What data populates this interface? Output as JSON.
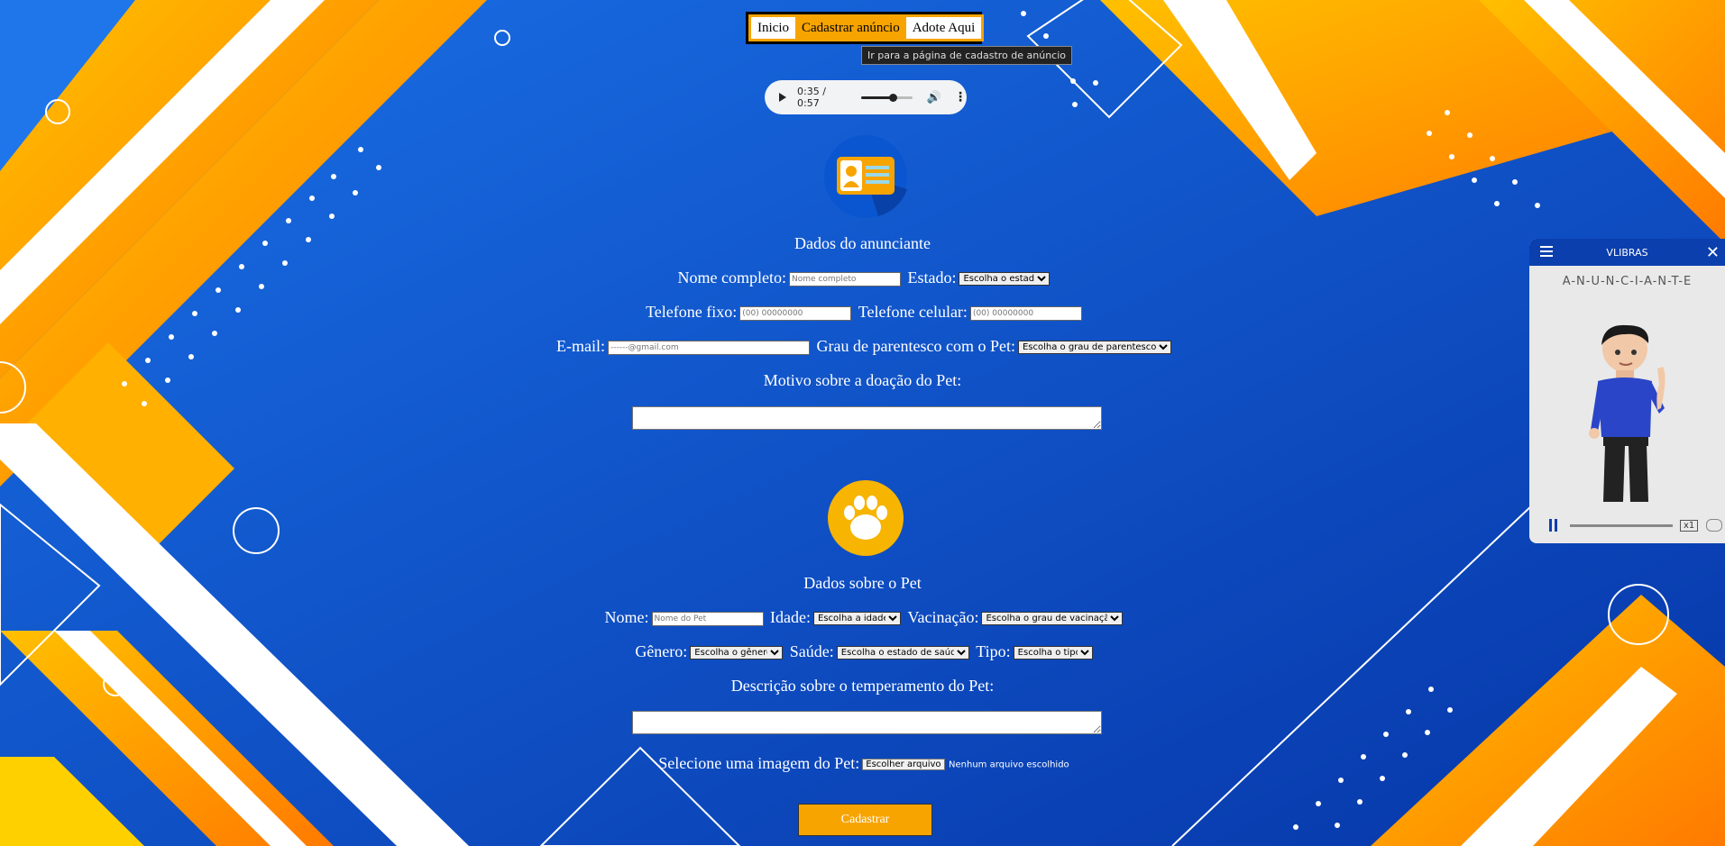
{
  "nav": {
    "items": [
      "Inicio",
      "Cadastrar anúncio",
      "Adote Aqui"
    ],
    "active_index": 1,
    "tooltip": "Ir para a página de cadastro de anúncio"
  },
  "audio": {
    "time": "0:35 / 0:57",
    "progress": 0.61
  },
  "advertiser": {
    "heading": "Dados do anunciante",
    "name_label": "Nome completo:",
    "name_placeholder": "Nome completo",
    "state_label": "Estado:",
    "state_selected": "Escolha o estado",
    "phone_label": "Telefone fixo:",
    "phone_placeholder": "(00) 00000000",
    "mobile_label": "Telefone celular:",
    "mobile_placeholder": "(00) 00000000",
    "email_label": "E-mail:",
    "email_placeholder": "------@gmail.com",
    "kinship_label": "Grau de parentesco com o Pet:",
    "kinship_selected": "Escolha o grau de parentesco",
    "reason_label": "Motivo sobre a doação do Pet:"
  },
  "pet": {
    "heading": "Dados sobre o Pet",
    "name_label": "Nome:",
    "name_placeholder": "Nome do Pet",
    "age_label": "Idade:",
    "age_selected": "Escolha a idade",
    "vaccine_label": "Vacinação:",
    "vaccine_selected": "Escolha o grau de vacinação",
    "gender_label": "Gênero:",
    "gender_selected": "Escolha o gênero",
    "health_label": "Saúde:",
    "health_selected": "Escolha o estado de saúde",
    "type_label": "Tipo:",
    "type_selected": "Escolha o tipo",
    "temperament_label": "Descrição sobre o temperamento do Pet:",
    "image_label": "Selecione uma imagem do Pet:",
    "file_button": "Escolher arquivo",
    "file_status": "Nenhum arquivo escolhido"
  },
  "submit_label": "Cadastrar",
  "vlibras": {
    "title": "VLIBRAS",
    "gloss": "A-N-U-N-C-I-A-N-T-E",
    "speed": "x1"
  },
  "colors": {
    "accent": "#f7a400",
    "background": "#0a3fb8",
    "vlibras": "#0b3fae"
  }
}
